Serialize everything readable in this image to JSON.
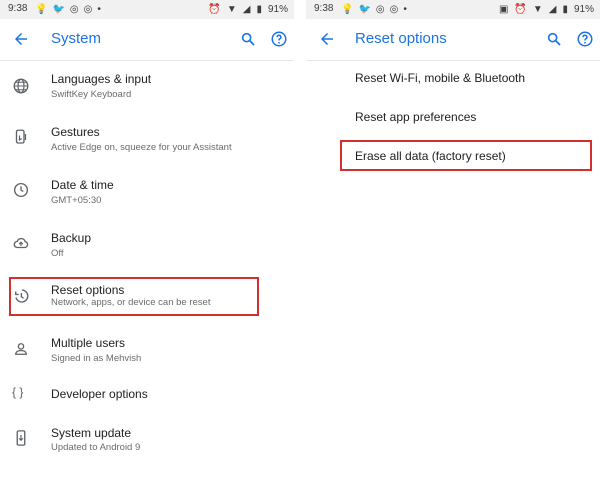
{
  "status_bar": {
    "time": "9:38",
    "battery": "91%"
  },
  "left": {
    "title": "System",
    "items": [
      {
        "label": "Languages & input",
        "sub": "SwiftKey Keyboard",
        "icon": "globe-icon"
      },
      {
        "label": "Gestures",
        "sub": "Active Edge on, squeeze for your Assistant",
        "icon": "gestures-icon"
      },
      {
        "label": "Date & time",
        "sub": "GMT+05:30",
        "icon": "clock-icon"
      },
      {
        "label": "Backup",
        "sub": "Off",
        "icon": "cloud-upload-icon"
      },
      {
        "label": "Reset options",
        "sub": "Network, apps, or device can be reset",
        "icon": "history-icon"
      },
      {
        "label": "Multiple users",
        "sub": "Signed in as Mehvish",
        "icon": "person-icon"
      },
      {
        "label": "Developer options",
        "sub": "",
        "icon": "braces-icon"
      },
      {
        "label": "System update",
        "sub": "Updated to Android 9",
        "icon": "phone-update-icon"
      }
    ]
  },
  "right": {
    "title": "Reset options",
    "items": [
      {
        "label": "Reset Wi-Fi, mobile & Bluetooth"
      },
      {
        "label": "Reset app preferences"
      },
      {
        "label": "Erase all data (factory reset)"
      }
    ]
  },
  "colors": {
    "accent": "#1a73e8",
    "highlight": "#d32f2f",
    "status_bar_bg": "#f1f1f1"
  }
}
